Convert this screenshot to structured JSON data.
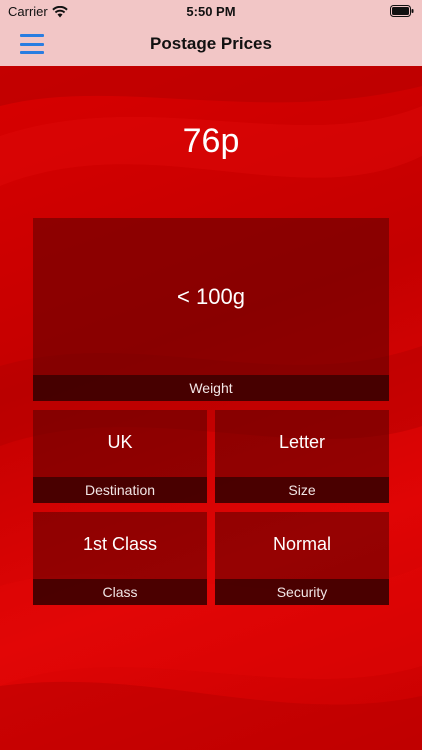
{
  "status_bar": {
    "carrier": "Carrier",
    "time": "5:50 PM"
  },
  "nav": {
    "title": "Postage Prices"
  },
  "price": "76p",
  "options": {
    "weight": {
      "value": "< 100g",
      "label": "Weight"
    },
    "destination": {
      "value": "UK",
      "label": "Destination"
    },
    "size": {
      "value": "Letter",
      "label": "Size"
    },
    "class": {
      "value": "1st Class",
      "label": "Class"
    },
    "security": {
      "value": "Normal",
      "label": "Security"
    }
  },
  "colors": {
    "accent": "#2a7de1",
    "background": "#c00000",
    "nav_background": "#f2c6c6"
  }
}
